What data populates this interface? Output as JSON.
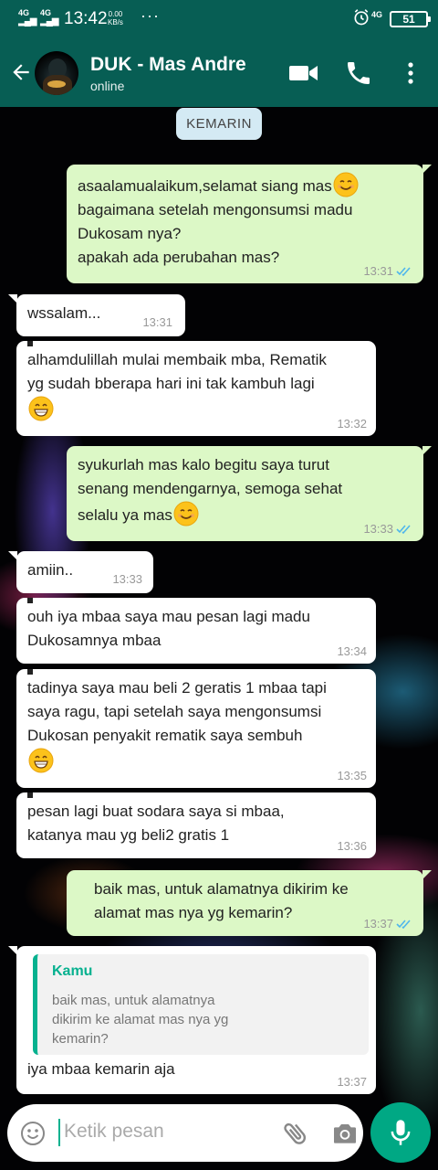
{
  "status_bar": {
    "signal_1": "4G",
    "signal_2": "4G",
    "time": "13:42",
    "net_speed_value": "0.00",
    "net_speed_unit": "KB/s",
    "more_indicator": "···",
    "network_right": "4G",
    "battery": "51"
  },
  "header": {
    "contact_name": "DUK - Mas Andre",
    "presence": "online",
    "icons": [
      "back-arrow-icon",
      "video-call-icon",
      "voice-call-icon",
      "more-options-icon"
    ],
    "color": "#075e54"
  },
  "chat": {
    "date_chip": "KEMARIN",
    "messages": [
      {
        "dir": "out",
        "text": "asaalamualaikum,selamat siang mas",
        "text2": "bagaimana setelah mengonsumsi madu\nDukosam nya?\napakah ada perubahan mas?",
        "time": "13:31",
        "read": true
      },
      {
        "dir": "in",
        "text": "wssalam...",
        "time": "13:31"
      },
      {
        "dir": "in",
        "text": "alhamdulillah mulai membaik mba, Rematik\nyg sudah bberapa hari ini tak kambuh lagi",
        "time": "13:32"
      },
      {
        "dir": "out",
        "text": "syukurlah mas kalo begitu saya turut\nsenang mendengarnya, semoga sehat\nselalu ya mas",
        "time": "13:33",
        "read": true
      },
      {
        "dir": "in",
        "text": "amiin..",
        "time": "13:33"
      },
      {
        "dir": "in",
        "text": "ouh iya mbaa saya mau pesan lagi madu\nDukosamnya mbaa",
        "time": "13:34"
      },
      {
        "dir": "in",
        "text": "tadinya saya mau beli 2 geratis 1 mbaa tapi\nsaya ragu, tapi setelah saya mengonsumsi\nDukosan penyakit rematik saya sembuh",
        "time": "13:35"
      },
      {
        "dir": "in",
        "text": "pesan lagi buat sodara saya si mbaa,\nkatanya mau yg beli2 gratis 1",
        "time": "13:36"
      },
      {
        "dir": "out",
        "text": "baik mas, untuk alamatnya dikirim ke\nalamat mas nya yg kemarin?",
        "time": "13:37",
        "read": true
      },
      {
        "dir": "in",
        "quote_author": "Kamu",
        "quote_text": "baik mas, untuk alamatnya\ndikirim ke alamat mas nya yg\nkemarin?",
        "text": "iya mbaa kemarin aja",
        "time": "13:37"
      }
    ],
    "colors": {
      "outgoing": "#dcf8c6",
      "incoming": "#ffffff",
      "read_tick": "#4fb6ec",
      "quote_accent": "#06b18f"
    }
  },
  "composer": {
    "placeholder": "Ketik pesan",
    "icons": [
      "emoji-icon",
      "attachment-icon",
      "camera-icon",
      "microphone-icon"
    ],
    "mic_color": "#00a884"
  }
}
